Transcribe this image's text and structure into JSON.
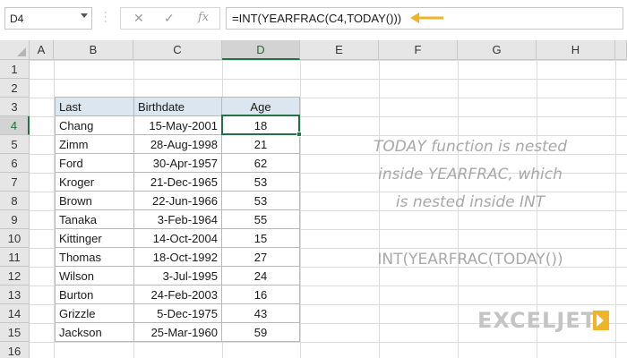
{
  "namebox": {
    "value": "D4"
  },
  "formula_bar": {
    "cancel_icon": "close-icon",
    "enter_icon": "check-icon",
    "fx_label": "fx",
    "formula": "=INT(YEARFRAC(C4,TODAY()))",
    "arrow_color": "#f0b429"
  },
  "columns": [
    "A",
    "B",
    "C",
    "D",
    "E",
    "F",
    "G",
    "H"
  ],
  "selected_column": "D",
  "rows": [
    "1",
    "2",
    "3",
    "4",
    "5",
    "6",
    "7",
    "8",
    "9",
    "10",
    "11",
    "12",
    "13",
    "14",
    "15",
    "16"
  ],
  "selected_row": "4",
  "table": {
    "headers": [
      "Last",
      "Birthdate",
      "Age"
    ],
    "rows": [
      [
        "Chang",
        "15-May-2001",
        "18"
      ],
      [
        "Zimm",
        "28-Aug-1998",
        "21"
      ],
      [
        "Ford",
        "30-Apr-1957",
        "62"
      ],
      [
        "Kroger",
        "21-Dec-1965",
        "53"
      ],
      [
        "Brown",
        "22-Jun-1966",
        "53"
      ],
      [
        "Tanaka",
        "3-Feb-1964",
        "55"
      ],
      [
        "Kittinger",
        "14-Oct-2004",
        "15"
      ],
      [
        "Thomas",
        "18-Oct-1992",
        "27"
      ],
      [
        "Wilson",
        "3-Jul-1995",
        "24"
      ],
      [
        "Burton",
        "24-Feb-2003",
        "16"
      ],
      [
        "Grizzle",
        "5-Dec-1975",
        "43"
      ],
      [
        "Jackson",
        "25-Mar-1960",
        "59"
      ]
    ]
  },
  "note": {
    "line1": "TODAY function is nested",
    "line2": "inside YEARFRAC, which",
    "line3": "is nested inside INT",
    "formula": "INT(YEARFRAC(TODAY())"
  },
  "logo": {
    "text": "EXCELJET"
  },
  "colors": {
    "accent": "#217346",
    "header_fill": "#dce6f0",
    "note_text": "#a8a8a8"
  }
}
